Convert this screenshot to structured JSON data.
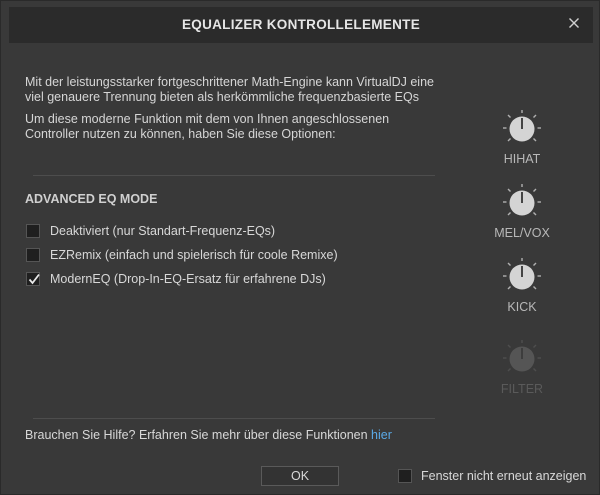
{
  "dialog": {
    "title": "EQUALIZER KONTROLLELEMENTE",
    "close_icon": "close-icon"
  },
  "intro": {
    "paragraph1": "Mit der leistungsstarker fortgeschrittener Math-Engine kann VirtualDJ eine viel genauere Trennung bieten als herkömmliche frequenzbasierte EQs",
    "paragraph2": "Um diese moderne Funktion mit dem von Ihnen angeschlossenen Controller nutzen zu können, haben Sie diese Optionen:"
  },
  "advanced_eq": {
    "title": "ADVANCED EQ MODE",
    "options": [
      {
        "label": "Deaktiviert (nur Standart-Frequenz-EQs)",
        "checked": false
      },
      {
        "label": "EZRemix (einfach und spielerisch für coole Remixe)",
        "checked": false
      },
      {
        "label": "ModernEQ (Drop-In-EQ-Ersatz für erfahrene DJs)",
        "checked": true
      }
    ]
  },
  "knobs": [
    {
      "label": "HIHAT",
      "enabled": true
    },
    {
      "label": "MEL/VOX",
      "enabled": true
    },
    {
      "label": "KICK",
      "enabled": true
    },
    {
      "label": "FILTER",
      "enabled": false
    }
  ],
  "help": {
    "text": "Brauchen Sie Hilfe? Erfahren Sie mehr über diese Funktionen ",
    "link": "hier"
  },
  "footer": {
    "ok_label": "OK",
    "dont_show_label": "Fenster nicht erneut anzeigen",
    "dont_show_checked": false
  },
  "colors": {
    "background": "#393939",
    "titlebar": "#2b2b2b",
    "link": "#5aa9e6"
  }
}
